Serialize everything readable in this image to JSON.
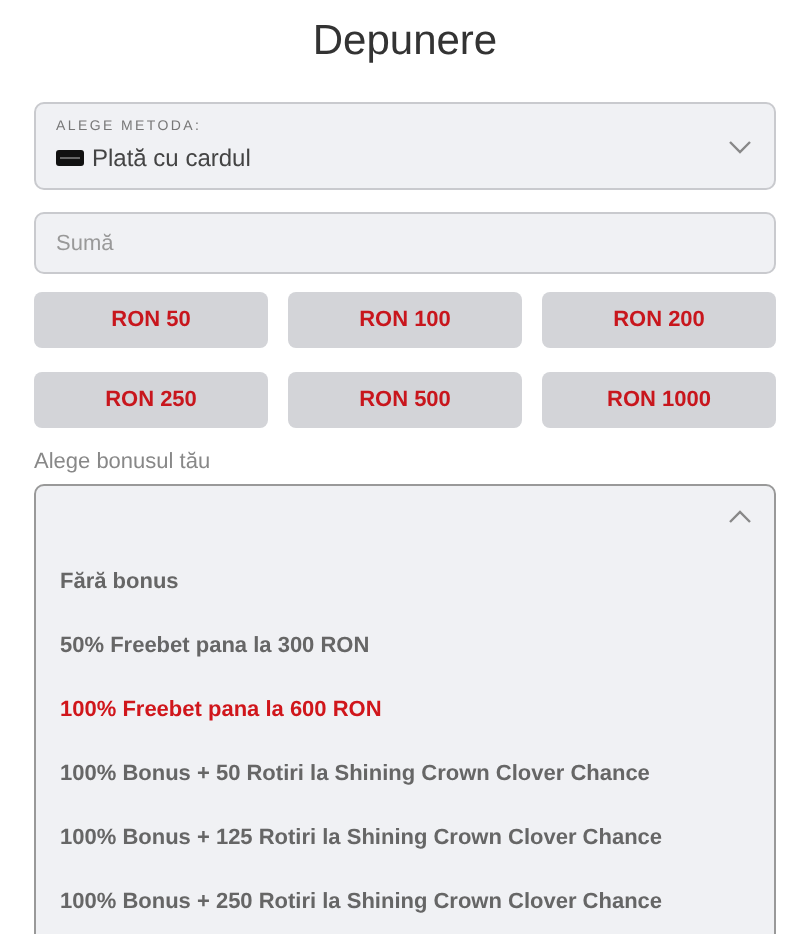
{
  "title": "Depunere",
  "method_select": {
    "label": "ALEGE METODA:",
    "value": "Plată cu cardul",
    "expanded": false
  },
  "amount_field": {
    "placeholder": "Sumă"
  },
  "amount_buttons": [
    "RON 50",
    "RON 100",
    "RON 200",
    "RON 250",
    "RON 500",
    "RON 1000"
  ],
  "bonus_label": "Alege bonusul tău",
  "bonus_dropdown": {
    "expanded": true,
    "options": [
      {
        "label": "Fără bonus",
        "selected": false
      },
      {
        "label": "50% Freebet pana la 300 RON",
        "selected": false
      },
      {
        "label": "100% Freebet pana la 600 RON",
        "selected": true
      },
      {
        "label": "100% Bonus + 50 Rotiri la Shining Crown Clover Chance",
        "selected": false
      },
      {
        "label": "100% Bonus + 125 Rotiri la Shining Crown Clover Chance",
        "selected": false
      },
      {
        "label": "100% Bonus + 250 Rotiri la Shining Crown Clover Chance",
        "selected": false
      }
    ]
  }
}
